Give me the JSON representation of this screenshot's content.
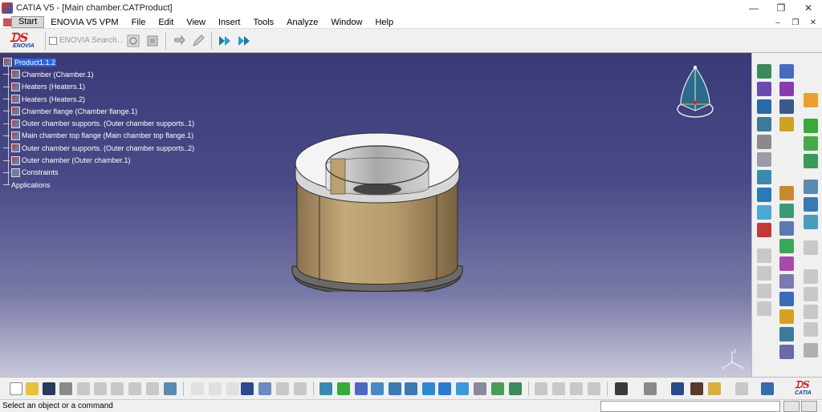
{
  "window": {
    "title": "CATIA V5 - [Main chamber.CATProduct]",
    "controls": [
      "minimize",
      "restore",
      "close"
    ]
  },
  "menubar": {
    "items": [
      "Start",
      "ENOVIA V5 VPM",
      "File",
      "Edit",
      "View",
      "Insert",
      "Tools",
      "Analyze",
      "Window",
      "Help"
    ],
    "active": "Start"
  },
  "top_toolbar": {
    "logo_text": "ENOVIA",
    "search_placeholder": "ENOVIA Search..."
  },
  "tree": {
    "root": "Product1.1.2",
    "nodes": [
      "Chamber (Chamber.1)",
      "Heaters (Heaters.1)",
      "Heaters (Heaters.2)",
      "Chamber flange (Chamber flange.1)",
      "Outer chamber supports. (Outer chamber supports..1)",
      "Main chamber top flange (Main chamber top flange.1)",
      "Outer chamber supports. (Outer chamber supports..2)",
      "Outer chamber (Outer chamber.1)",
      "Constraints"
    ],
    "footer": "Applications"
  },
  "viewport": {
    "axis_labels": {
      "z": "z",
      "x": "x",
      "y": "y"
    },
    "background_top": "#3a3a78",
    "background_bottom": "#c9c9dc"
  },
  "status": {
    "message": "Select an object or a command",
    "command_input": ""
  },
  "bottom_logo_text": "CATIA",
  "icons": {
    "top": [
      "enovia-logo-icon",
      "search-icon",
      "object-icon",
      "refresh-icon",
      "pencil-icon",
      "flag-icon-1",
      "flag-icon-2"
    ],
    "bottom": [
      "new-icon",
      "open-icon",
      "save-icon",
      "print-icon",
      "cut-icon",
      "copy-icon",
      "paste-icon",
      "undo-icon",
      "redo-icon",
      "whats-this-icon",
      "formula-icon",
      "search-icon",
      "grid-icon",
      "tree-icon",
      "fly-icon",
      "pan-icon",
      "rotate-icon",
      "zoom-in-icon",
      "zoom-out-icon",
      "normal-view-icon",
      "multi-view-icon",
      "iso-view-icon",
      "shading-icon",
      "hide-show-icon",
      "swap-icon",
      "measure-icon",
      "snapshot-icon",
      "catia-logo-icon"
    ]
  }
}
